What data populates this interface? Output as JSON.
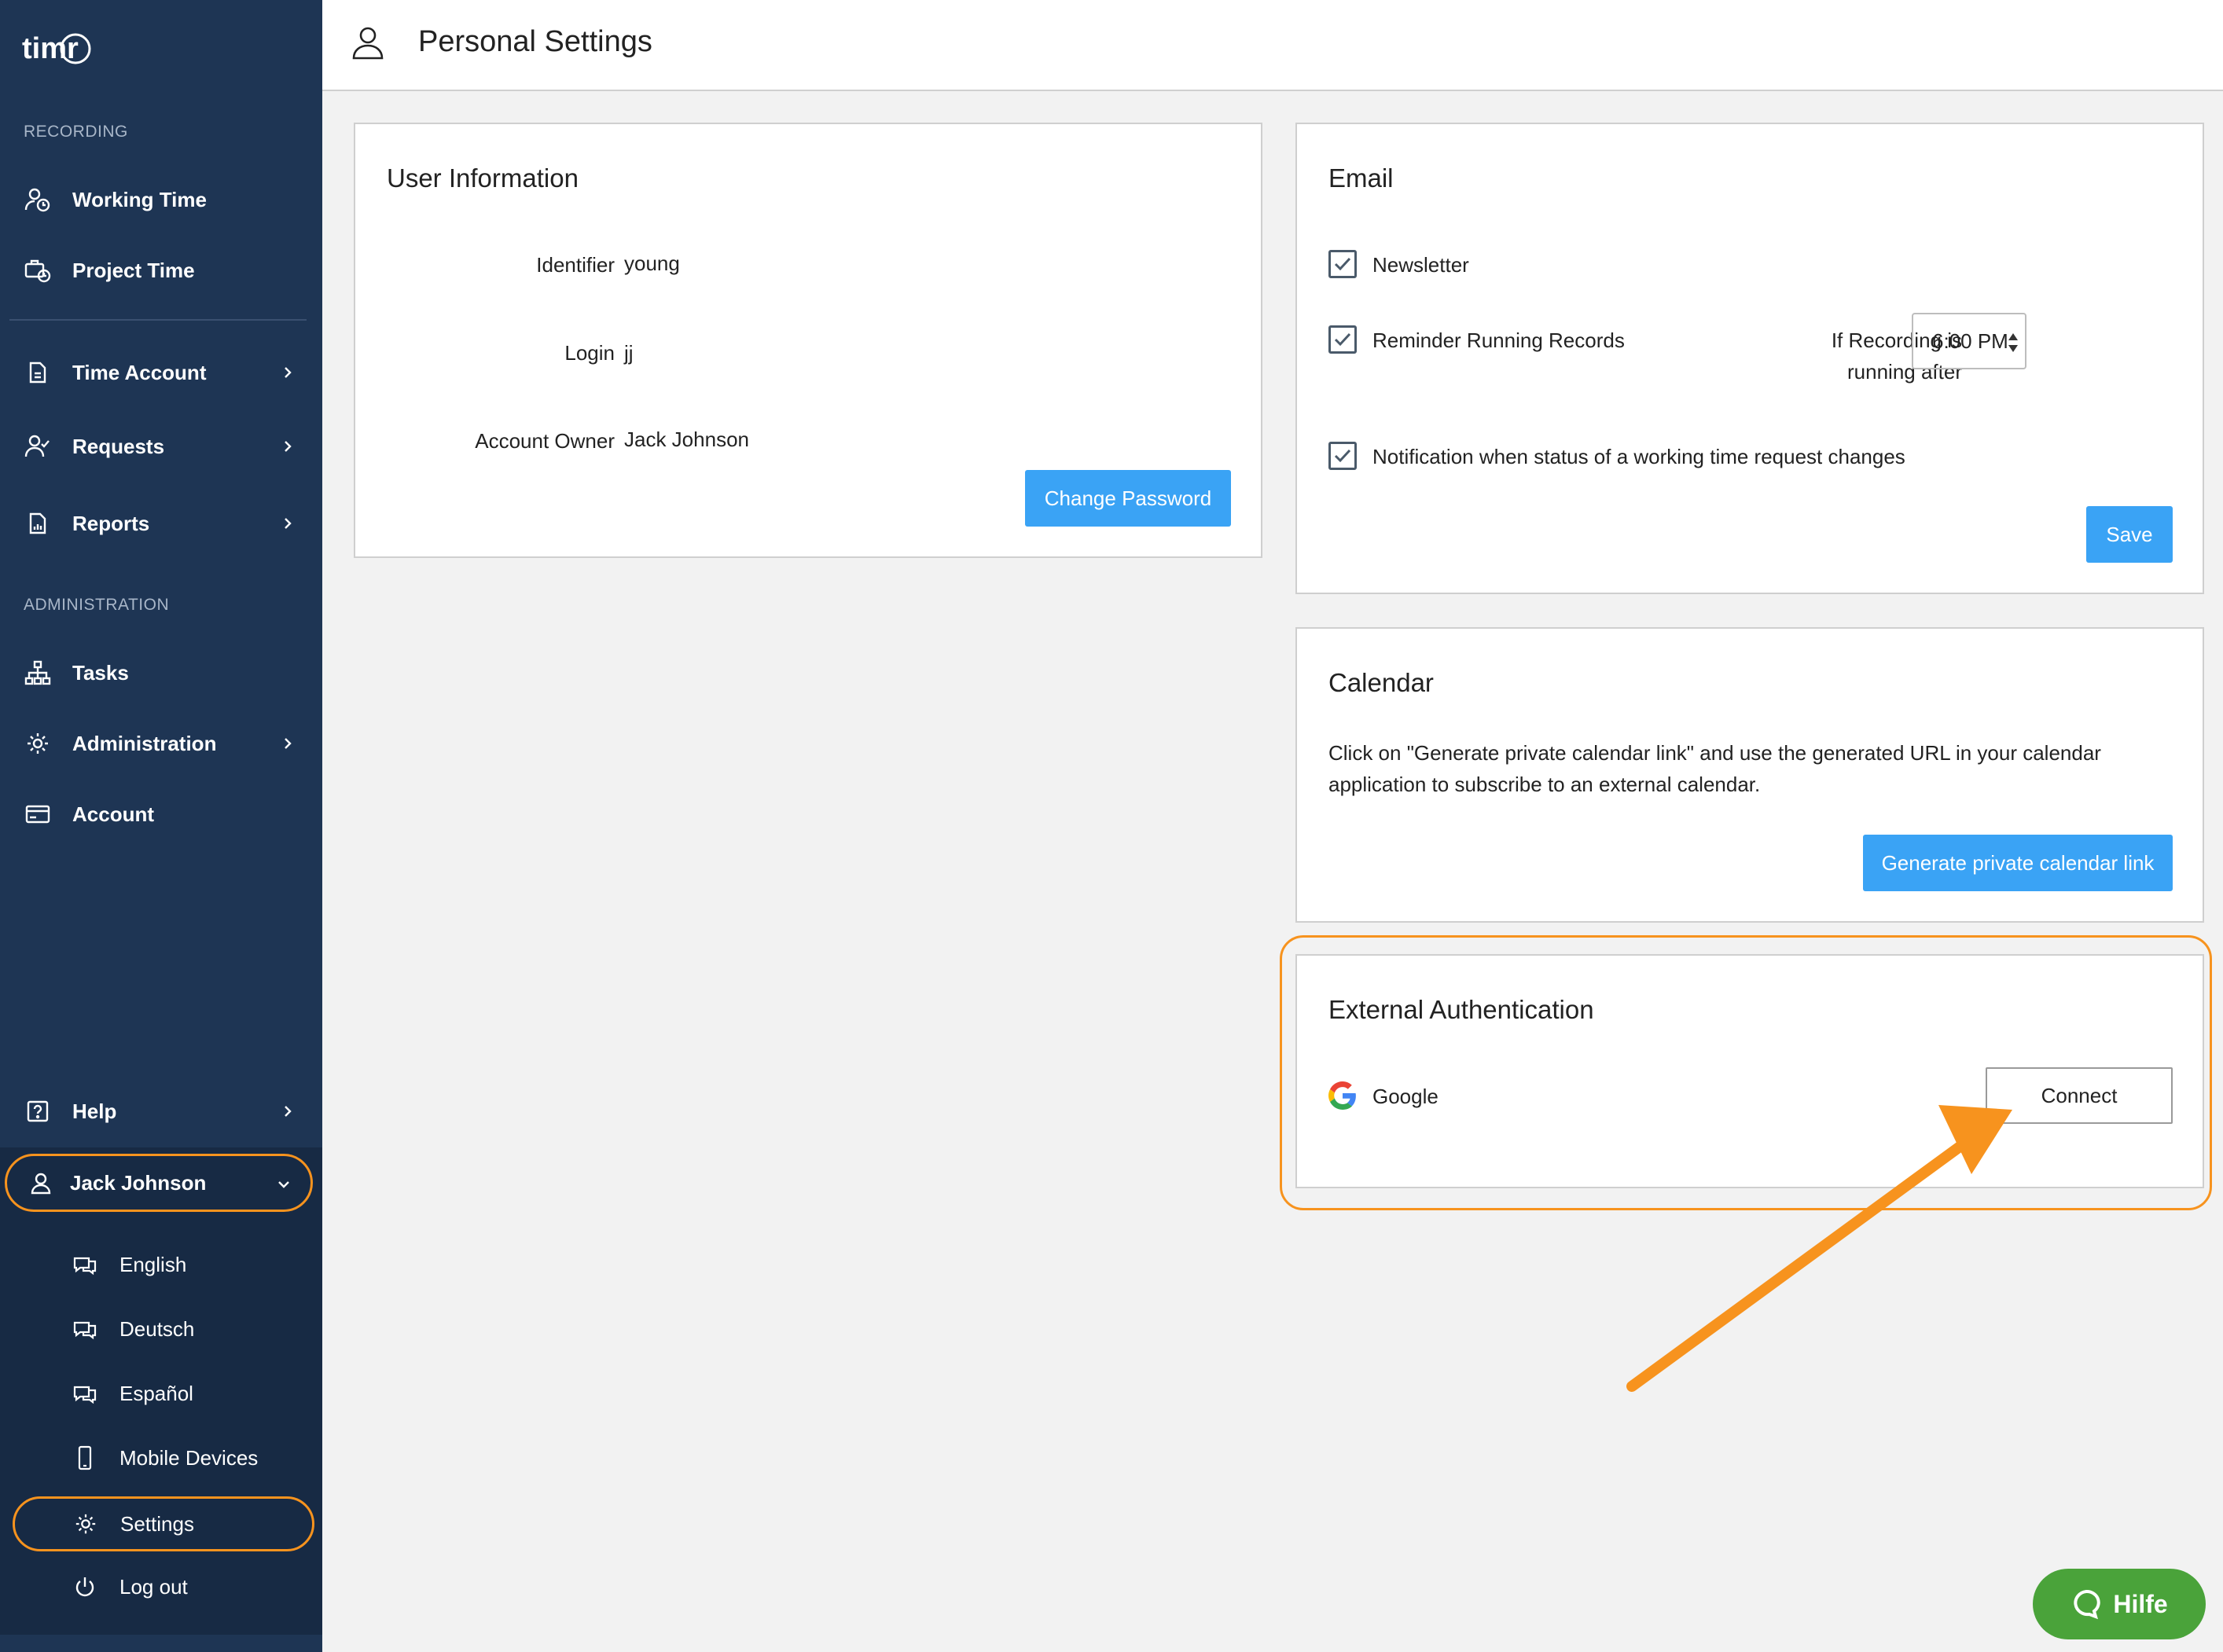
{
  "app": {
    "logo_text": "timr"
  },
  "sidebar": {
    "sections": {
      "recording": "RECORDING",
      "administration": "ADMINISTRATION"
    },
    "items": [
      {
        "label": "Working Time",
        "icon": "user-clock-icon"
      },
      {
        "label": "Project Time",
        "icon": "briefcase-clock-icon"
      },
      {
        "label": "Time Account",
        "icon": "document-icon"
      },
      {
        "label": "Requests",
        "icon": "user-check-icon"
      },
      {
        "label": "Reports",
        "icon": "report-icon"
      },
      {
        "label": "Tasks",
        "icon": "hierarchy-icon"
      },
      {
        "label": "Administration",
        "icon": "gear-icon"
      },
      {
        "label": "Account",
        "icon": "credit-card-icon"
      },
      {
        "label": "Help",
        "icon": "question-icon"
      }
    ],
    "user": {
      "name": "Jack Johnson"
    },
    "submenu": [
      {
        "label": "English",
        "icon": "chat-icon"
      },
      {
        "label": "Deutsch",
        "icon": "chat-icon"
      },
      {
        "label": "Español",
        "icon": "chat-icon"
      },
      {
        "label": "Mobile Devices",
        "icon": "phone-icon"
      },
      {
        "label": "Settings",
        "icon": "gear-icon"
      },
      {
        "label": "Log out",
        "icon": "power-icon"
      }
    ]
  },
  "header": {
    "title": "Personal Settings"
  },
  "user_info": {
    "title": "User Information",
    "fields": [
      {
        "label": "Identifier",
        "value": "young"
      },
      {
        "label": "Login",
        "value": "jj"
      },
      {
        "label": "Account Owner",
        "value": "Jack Johnson"
      }
    ],
    "change_password": "Change Password"
  },
  "email": {
    "title": "Email",
    "newsletter": "Newsletter",
    "reminder": "Reminder Running Records",
    "recording_label_1": "If Recording is",
    "recording_label_2": "running after",
    "time_value": "6:00 PM",
    "notification": "Notification when status of a working time request changes",
    "save": "Save"
  },
  "calendar": {
    "title": "Calendar",
    "description": "Click on \"Generate private calendar link\" and use the generated URL in your calendar application to subscribe to an external calendar.",
    "generate": "Generate private calendar link"
  },
  "external_auth": {
    "title": "External Authentication",
    "provider": "Google",
    "connect": "Connect"
  },
  "help_bubble": {
    "label": "Hilfe"
  },
  "colors": {
    "sidebar": "#1e3554",
    "accent": "#3aa3f5",
    "highlight": "#f7931e",
    "help": "#4aa33a"
  }
}
